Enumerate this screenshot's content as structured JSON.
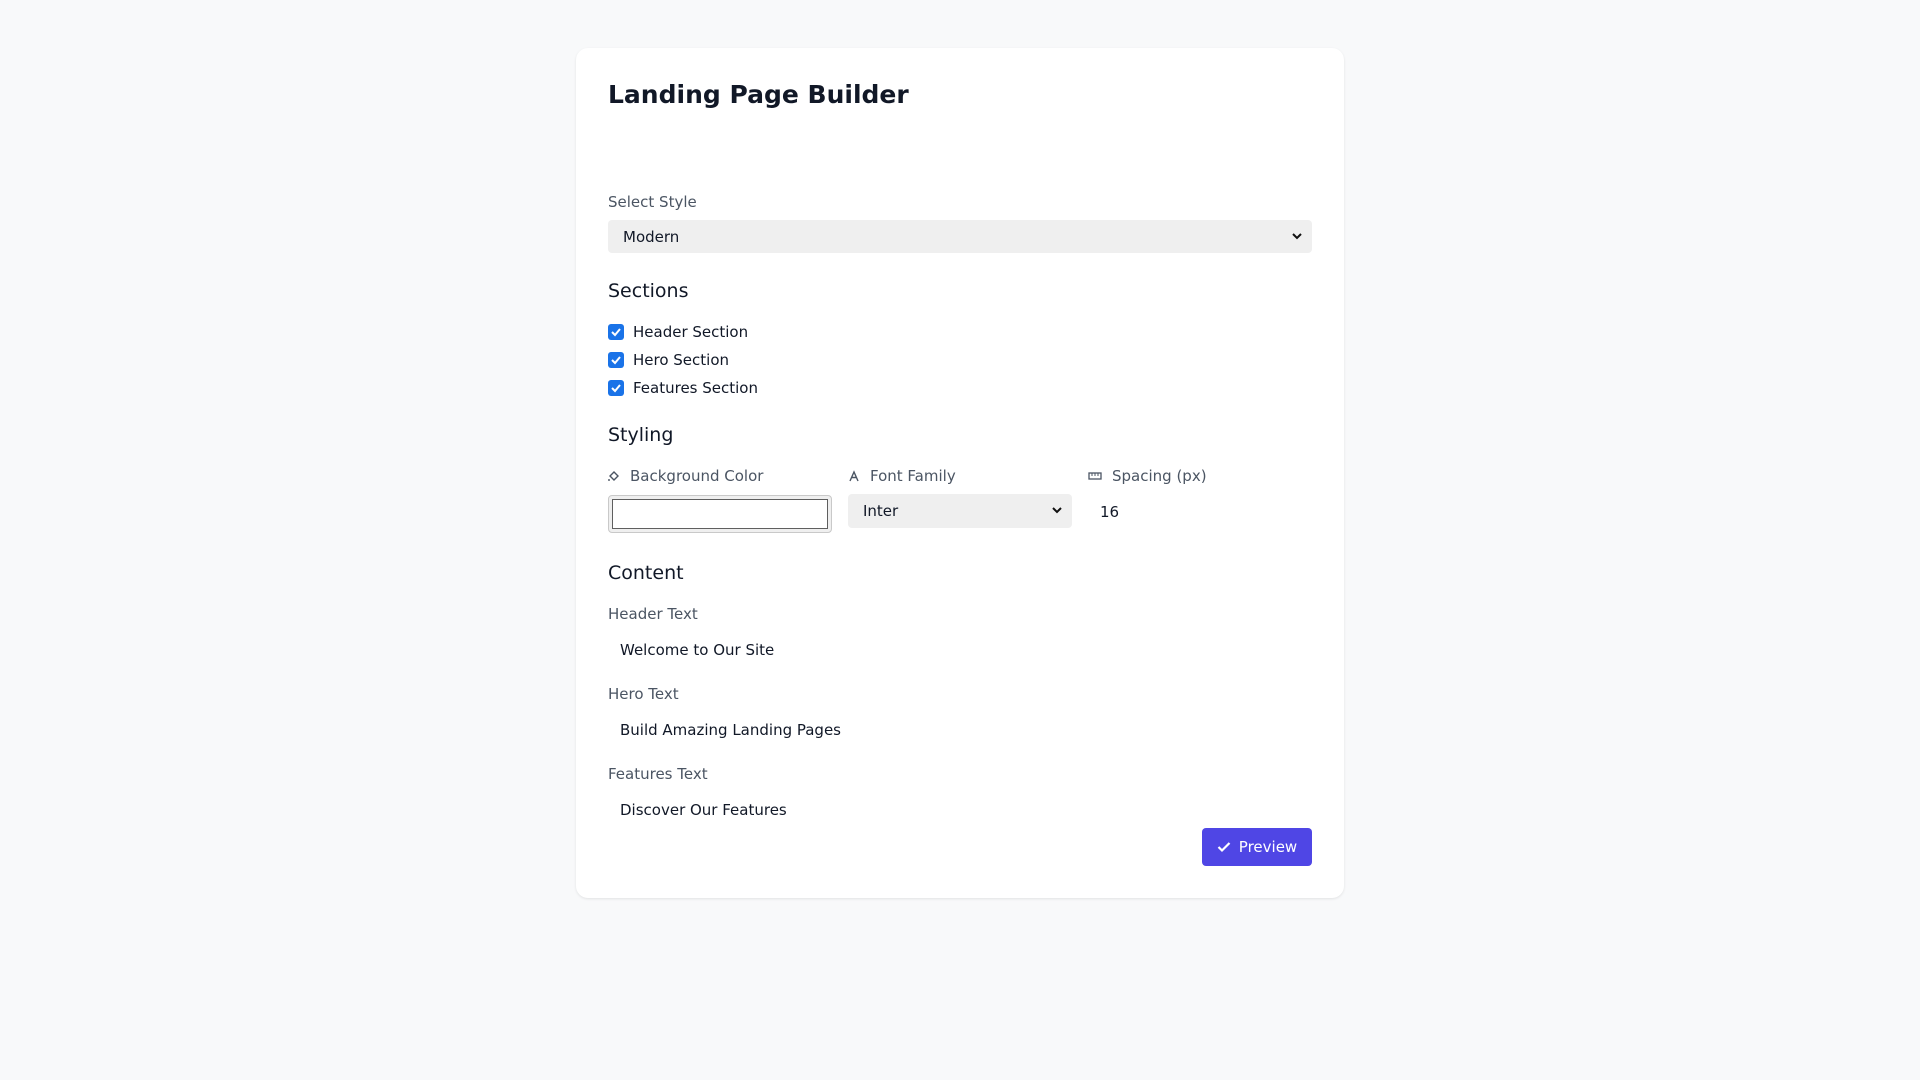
{
  "title": "Landing Page Builder",
  "style_select": {
    "label": "Select Style",
    "value": "Modern"
  },
  "sections": {
    "heading": "Sections",
    "items": [
      {
        "label": "Header Section",
        "checked": true
      },
      {
        "label": "Hero Section",
        "checked": true
      },
      {
        "label": "Features Section",
        "checked": true
      }
    ]
  },
  "styling": {
    "heading": "Styling",
    "background_color": {
      "label": "Background Color",
      "icon": "paint-bucket-icon",
      "value": "#ffffff"
    },
    "font_family": {
      "label": "Font Family",
      "icon": "font-icon",
      "value": "Inter"
    },
    "spacing": {
      "label": "Spacing (px)",
      "icon": "ruler-icon",
      "value": "16"
    }
  },
  "content": {
    "heading": "Content",
    "header_text": {
      "label": "Header Text",
      "value": "Welcome to Our Site"
    },
    "hero_text": {
      "label": "Hero Text",
      "value": "Build Amazing Landing Pages"
    },
    "features_text": {
      "label": "Features Text",
      "value": "Discover Our Features"
    }
  },
  "preview_button": {
    "label": "Preview",
    "icon": "check-icon"
  },
  "colors": {
    "accent": "#4f46e5",
    "checkbox": "#1a73e8",
    "page_bg": "#f8f9fa"
  }
}
